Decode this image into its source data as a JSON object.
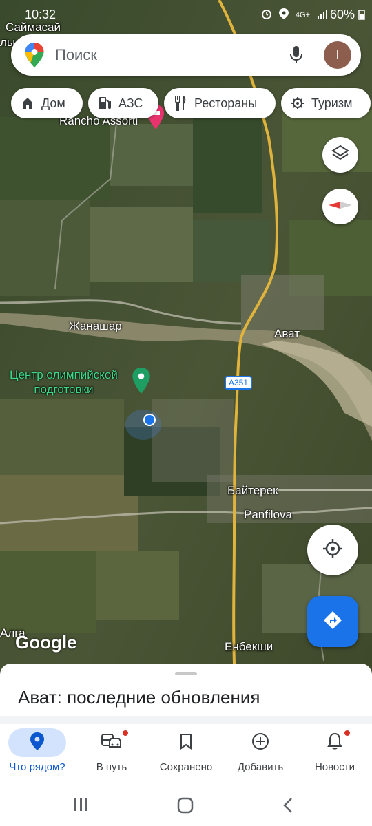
{
  "status": {
    "time": "10:32",
    "network": "4G+",
    "battery": "60%"
  },
  "search": {
    "placeholder": "Поиск",
    "avatar_initial": "I"
  },
  "chips": [
    {
      "label": "Дом",
      "icon": "home-icon"
    },
    {
      "label": "АЗС",
      "icon": "gas-station-icon"
    },
    {
      "label": "Рестораны",
      "icon": "restaurant-icon"
    },
    {
      "label": "Туризм",
      "icon": "tourism-icon"
    }
  ],
  "map": {
    "places": {
      "saimasai": "Саймасай",
      "ly": "лы",
      "rancho": "Rancho Assorti",
      "zhanashar": "Жанашар",
      "avat": "Ават",
      "center_line1": "Центр олимпийской",
      "center_line2": "подготовки",
      "baiterek": "Байтерек",
      "panfilova": "Panfilova",
      "alga": "Алга",
      "enbekshi": "Енбекши"
    },
    "route_shield": "A351",
    "attribution": "Google"
  },
  "sheet": {
    "title": "Ават: последние обновления"
  },
  "nav": [
    {
      "label": "Что рядом?",
      "icon": "explore-pin-icon",
      "active": true
    },
    {
      "label": "В путь",
      "icon": "commute-icon",
      "badge": true
    },
    {
      "label": "Сохранено",
      "icon": "bookmark-icon"
    },
    {
      "label": "Добавить",
      "icon": "add-circle-icon"
    },
    {
      "label": "Новости",
      "icon": "bell-icon",
      "badge": true
    }
  ],
  "colors": {
    "accent": "#1a73e8",
    "road": "#e0b43c",
    "place_green": "#3dd98a",
    "active_nav_bg": "#d3e3fd"
  }
}
